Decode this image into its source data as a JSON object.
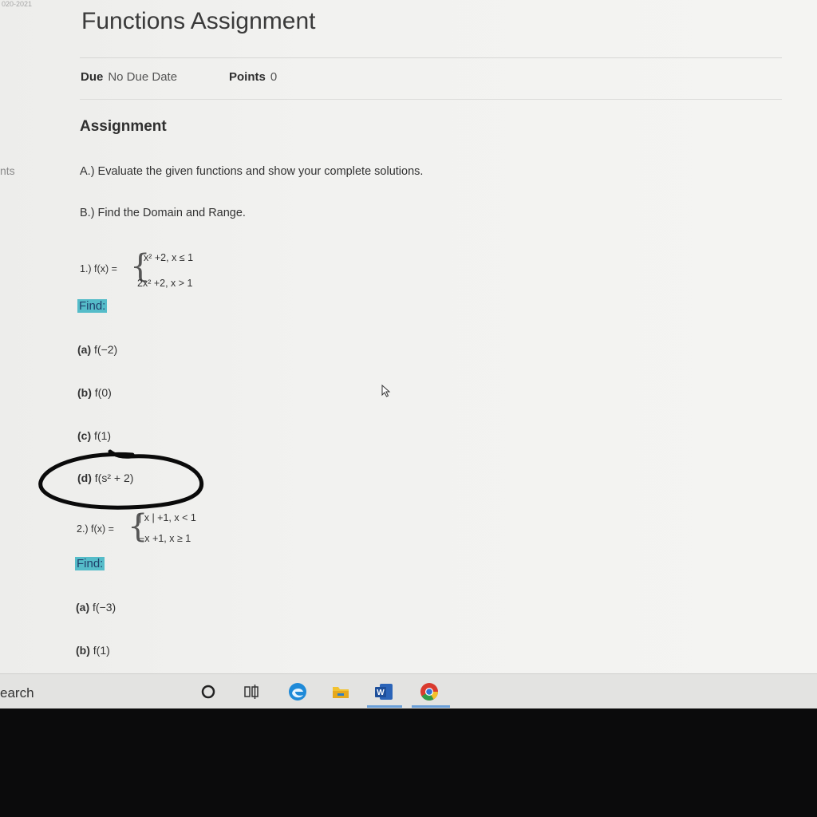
{
  "breadcrumb": "020-2021",
  "side_fragment": "nts",
  "title": "Functions Assignment",
  "meta": {
    "due_label": "Due",
    "due_value": "No Due Date",
    "points_label": "Points",
    "points_value": "0"
  },
  "heading": "Assignment",
  "instructions": {
    "a": "A.) Evaluate the given functions and show your complete solutions.",
    "b": "B.) Find the Domain and Range."
  },
  "problem1": {
    "label": "1.) f(x) =",
    "case1": "x² +2, x ≤ 1",
    "case2": "2x² +2, x > 1",
    "find": "Find:",
    "items": [
      {
        "letter": "(a)",
        "expr": "f(−2)"
      },
      {
        "letter": "(b)",
        "expr": "f(0)"
      },
      {
        "letter": "(c)",
        "expr": "f(1)"
      },
      {
        "letter": "(d)",
        "expr": "f(s² + 2)"
      }
    ]
  },
  "problem2": {
    "label": "2.) f(x) =",
    "case1": "| x | +1, x < 1",
    "case2": "−x +1, x ≥ 1",
    "find": "Find:",
    "items": [
      {
        "letter": "(a)",
        "expr": "f(−3)"
      },
      {
        "letter": "(b)",
        "expr": "f(1)"
      }
    ]
  },
  "taskbar": {
    "search_text": "earch",
    "icons": [
      "cortana-icon",
      "task-view-icon",
      "edge-icon",
      "file-explorer-icon",
      "word-icon",
      "chrome-icon"
    ]
  },
  "colors": {
    "find_highlight": "#55bcc9",
    "taskbar_underline": "#6a9fd8"
  }
}
